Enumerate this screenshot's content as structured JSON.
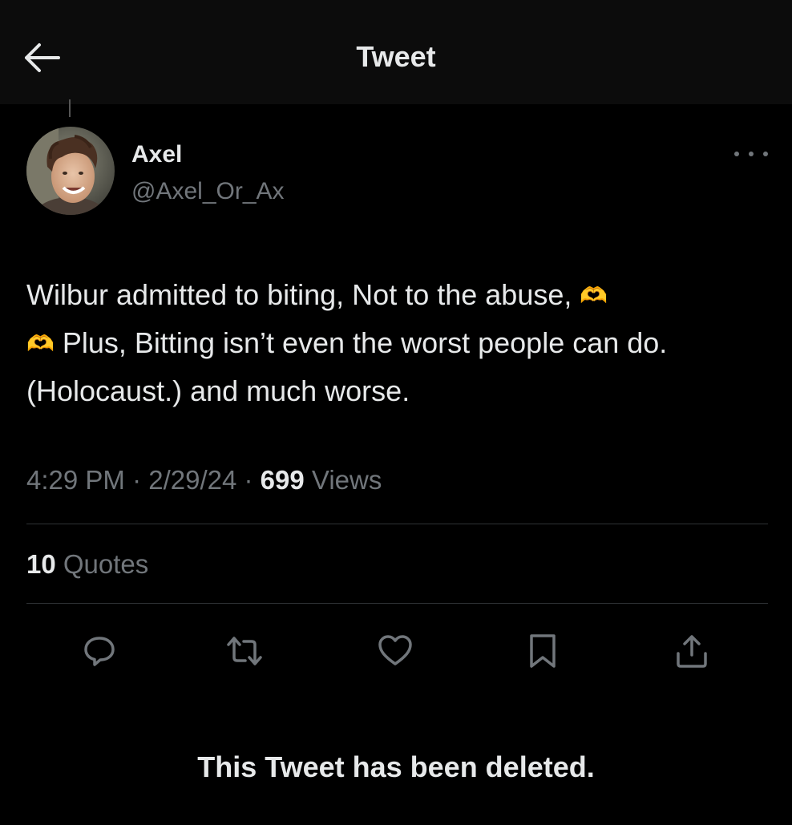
{
  "header": {
    "title": "Tweet",
    "back_icon": "arrow-left-icon"
  },
  "author": {
    "name": "Axel",
    "handle": "@Axel_Or_Ax",
    "avatar": "avatar-photo"
  },
  "tweet": {
    "segments": [
      "Wilbur admitted to biting, Not to the abuse, ",
      "\n",
      " Plus, Bitting isn’t even the worst people can do. (Holocaust.) and much worse."
    ],
    "emoji": "🫶"
  },
  "meta": {
    "time": "4:29 PM",
    "sep1": " · ",
    "date": "2/29/24",
    "sep2": " · ",
    "views_count": "699",
    "views_label": " Views"
  },
  "quotes": {
    "count": "10",
    "label": " Quotes"
  },
  "actions": [
    {
      "name": "reply",
      "icon": "reply-icon"
    },
    {
      "name": "retweet",
      "icon": "retweet-icon"
    },
    {
      "name": "like",
      "icon": "heart-icon"
    },
    {
      "name": "bookmark",
      "icon": "bookmark-icon"
    },
    {
      "name": "share",
      "icon": "share-icon"
    }
  ],
  "deleted_notice": "This Tweet has been deleted.",
  "colors": {
    "background": "#000000",
    "header_bg": "#0c0c0c",
    "text": "#e7e9ea",
    "secondary_text": "#71767b",
    "divider": "#2f3336",
    "emoji_yellow": "#f5b800"
  }
}
